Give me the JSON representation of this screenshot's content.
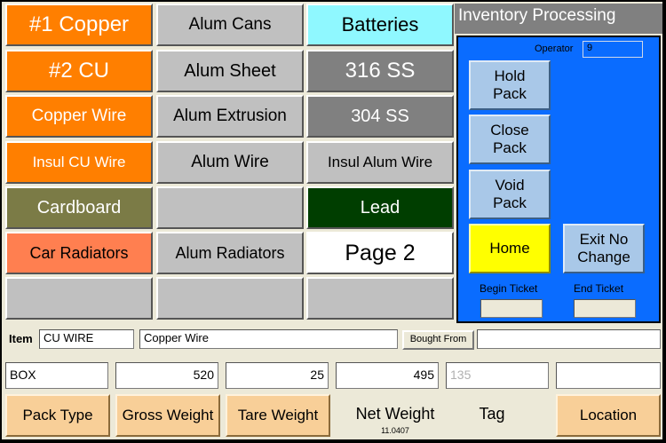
{
  "grid": {
    "col1": [
      "#1 Copper",
      "#2 CU",
      "Copper Wire",
      "Insul CU Wire",
      "Cardboard",
      "Car Radiators",
      ""
    ],
    "col2": [
      "Alum Cans",
      "Alum Sheet",
      "Alum Extrusion",
      "Alum Wire",
      "",
      "Alum Radiators",
      ""
    ],
    "col3": [
      "Batteries",
      "316 SS",
      "304 SS",
      "Insul Alum Wire",
      "Lead",
      "Page 2",
      ""
    ]
  },
  "panel": {
    "title": "Inventory Processing",
    "operator_label": "Operator",
    "operator_value": "9",
    "hold_pack": "Hold\nPack",
    "close_pack": "Close\nPack",
    "void_pack": "Void\nPack",
    "home": "Home",
    "exit_no_change": "Exit No\nChange",
    "begin_ticket_label": "Begin Ticket",
    "end_ticket_label": "End Ticket",
    "begin_ticket_value": "",
    "end_ticket_value": ""
  },
  "item_row": {
    "label": "Item",
    "code": "CU WIRE",
    "description": "Copper Wire",
    "bought_from_label": "Bought From",
    "bought_from_value": ""
  },
  "values": {
    "pack_type": "BOX",
    "gross_weight": "520",
    "tare_weight": "25",
    "net_weight": "495",
    "tag": "135",
    "location": ""
  },
  "bottom": {
    "pack_type": "Pack Type",
    "gross_weight": "Gross Weight",
    "tare_weight": "Tare Weight",
    "net_weight_label": "Net Weight",
    "net_weight_sub": "11.0407",
    "tag_label": "Tag",
    "location": "Location"
  },
  "colors": {
    "orange": "#ff7f00",
    "salmon": "#ff7f50",
    "olive": "#7b7b46",
    "gray_light": "#c0c0c0",
    "gray_dark": "#808080",
    "cyan": "#8ff8ff",
    "dark_green": "#003e00",
    "white": "#ffffff",
    "panel_blue": "#0a6cff",
    "yellow": "#ffff00",
    "bottom_btn": "#f8cf98"
  }
}
